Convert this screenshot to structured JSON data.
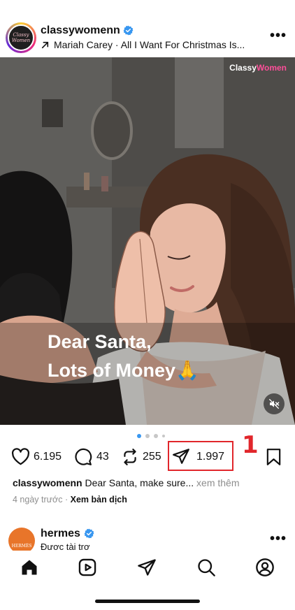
{
  "post": {
    "username": "classywomenn",
    "avatar_text": "Classy Women",
    "music": "Mariah Carey · All I Want For Christmas Is...",
    "brand_tag_white": "Classy",
    "brand_tag_pink": "Women",
    "image_caption": [
      "Dear Santa,",
      "Lots of Money🙏"
    ],
    "carousel": {
      "total": 4,
      "active_index": 0
    },
    "likes": "6.195",
    "comments": "43",
    "reposts": "255",
    "shares": "1.997",
    "caption_user": "classywomenn",
    "caption_text": "Dear Santa, make sure...",
    "see_more": "xem thêm",
    "time_ago": "4 ngày trước",
    "separator": "·",
    "translate": "Xem bản dịch"
  },
  "annotation": {
    "label": "1",
    "color": "#e1262b"
  },
  "next_post": {
    "username": "hermes",
    "avatar_text": "HERMÈS",
    "sponsored": "Được tài trợ"
  },
  "nav": {
    "items": [
      "home-icon",
      "reels-icon",
      "send-icon",
      "search-icon",
      "profile-icon"
    ],
    "active": "home-icon"
  },
  "colors": {
    "verified": "#3897f0",
    "annotation": "#e1262b",
    "text": "#111111",
    "muted": "#8e8e8e"
  }
}
